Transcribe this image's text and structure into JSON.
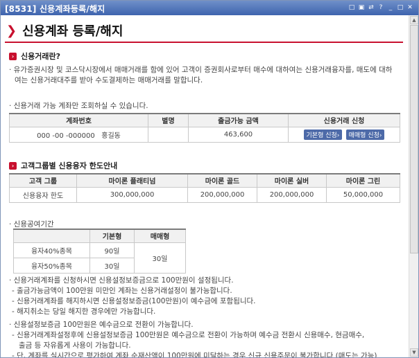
{
  "window": {
    "title": "[8531] 신용계좌등록/해지",
    "buttons": [
      "□",
      "▣",
      "⇄",
      "?",
      "_",
      "□",
      "✕"
    ]
  },
  "page": {
    "title": "신용계좌 등록/해지"
  },
  "section1": {
    "heading": "신용거래란?",
    "text_line1": "· 유가증권시장 및 코스닥시장에서 매매거래를 함에 있어 고객이 증권회사로부터 매수에 대하여는 신용거래융자를, 매도에 대하",
    "text_line2": "여는 신용거래대주를 받아 수도결제하는 매매거래를 말합니다."
  },
  "account_note": "· 신용거래 가능 계좌만 조회하실 수 있습니다.",
  "account_table": {
    "headers": [
      "계좌번호",
      "별명",
      "출금가능 금액",
      "신용거래 신청"
    ],
    "row": {
      "account": "000 -00 -000000",
      "owner": "홍길동",
      "nickname": "",
      "amount": "463,600",
      "btn_basic": "기본형 신청›",
      "btn_trade": "매매형 신청›"
    }
  },
  "section2": {
    "heading": "고객그룹별 신용융자 한도안내"
  },
  "limit_table": {
    "headers": [
      "고객 그룹",
      "마이론 플래티넘",
      "마이론 골드",
      "마이론 실버",
      "마이론 그린"
    ],
    "row": [
      "신용융자 한도",
      "300,000,000",
      "200,000,000",
      "200,000,000",
      "50,000,000"
    ]
  },
  "period": {
    "label": "· 신용공여기간",
    "headers": [
      "",
      "기본형",
      "매매형"
    ],
    "rows": [
      {
        "name": "융자40%종목",
        "basic": "90일"
      },
      {
        "name": "융자50%종목",
        "basic": "30일"
      }
    ],
    "merged_trade": "30일"
  },
  "notes1": {
    "line1": "· 신용거래계좌를 신청하시면 신용설정보증금으로 100만원이 설정됩니다.",
    "line2": "- 출금가능금액이 100만원 미만인 계좌는 신용거래설정이 불가능합니다.",
    "line3": "- 신용거래계좌를 해지하시면 신용설정보증금(100만원)이 예수금에 포함됩니다.",
    "line4": "- 해지취소는 당일 해지한 경우에만 가능합니다."
  },
  "notes2": {
    "line1": "· 신용설정보증금 100만원은 예수금으로 전환이 가능합니다.",
    "line2": "- 신용거래계좌설정후에 신용설정보증금 100만원은 예수금으로 전환이 가능하며 예수금 전환시 신용매수, 현금매수,",
    "line3": "출금 등 자유롭게 사용이 가능합니다.",
    "line4": "- 단, 계좌를 실시간으로 평가하여 계좌 순재산액이 100만원에 미달하는 경우 신규 신용주문이 불가합니다 (매도는 가능)"
  }
}
